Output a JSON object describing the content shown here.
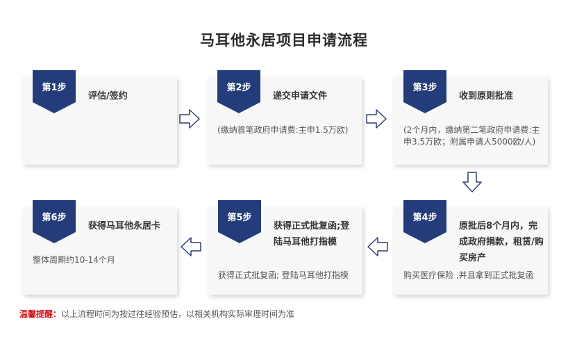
{
  "title": "马耳他永居项目申请流程",
  "steps": [
    {
      "badge": "第1步",
      "heading": "评估/签约",
      "description": ""
    },
    {
      "badge": "第2步",
      "heading": "递交申请文件",
      "description": "(缴纳首笔政府申请费:主申1.5万欧)"
    },
    {
      "badge": "第3步",
      "heading": "收到原则批准",
      "description": "(2个月内，缴纳第二笔政府申请费:主申3.5万欧；附属申请人5000欧/人)"
    },
    {
      "badge": "第4步",
      "heading": "原批后8个月内，完成政府捐款，租赁/购买房产",
      "description": "购买医疗保险 ,并且拿到正式批复函"
    },
    {
      "badge": "第5步",
      "heading": "获得正式批复函;登陆马耳他打指模",
      "description": "获得正式批复函; 登陆马耳他打指模"
    },
    {
      "badge": "第6步",
      "heading": "获得马耳他永居卡",
      "description": "整体周期约10-14个月"
    }
  ],
  "note": {
    "label": "温馨提醒：",
    "text": "以上流程时间为按过往经验预估，以相关机构实际审理时间为准"
  },
  "colors": {
    "badge": "#243d7a",
    "arrow_stroke": "#2b3f73",
    "note_label": "#d8141b"
  }
}
